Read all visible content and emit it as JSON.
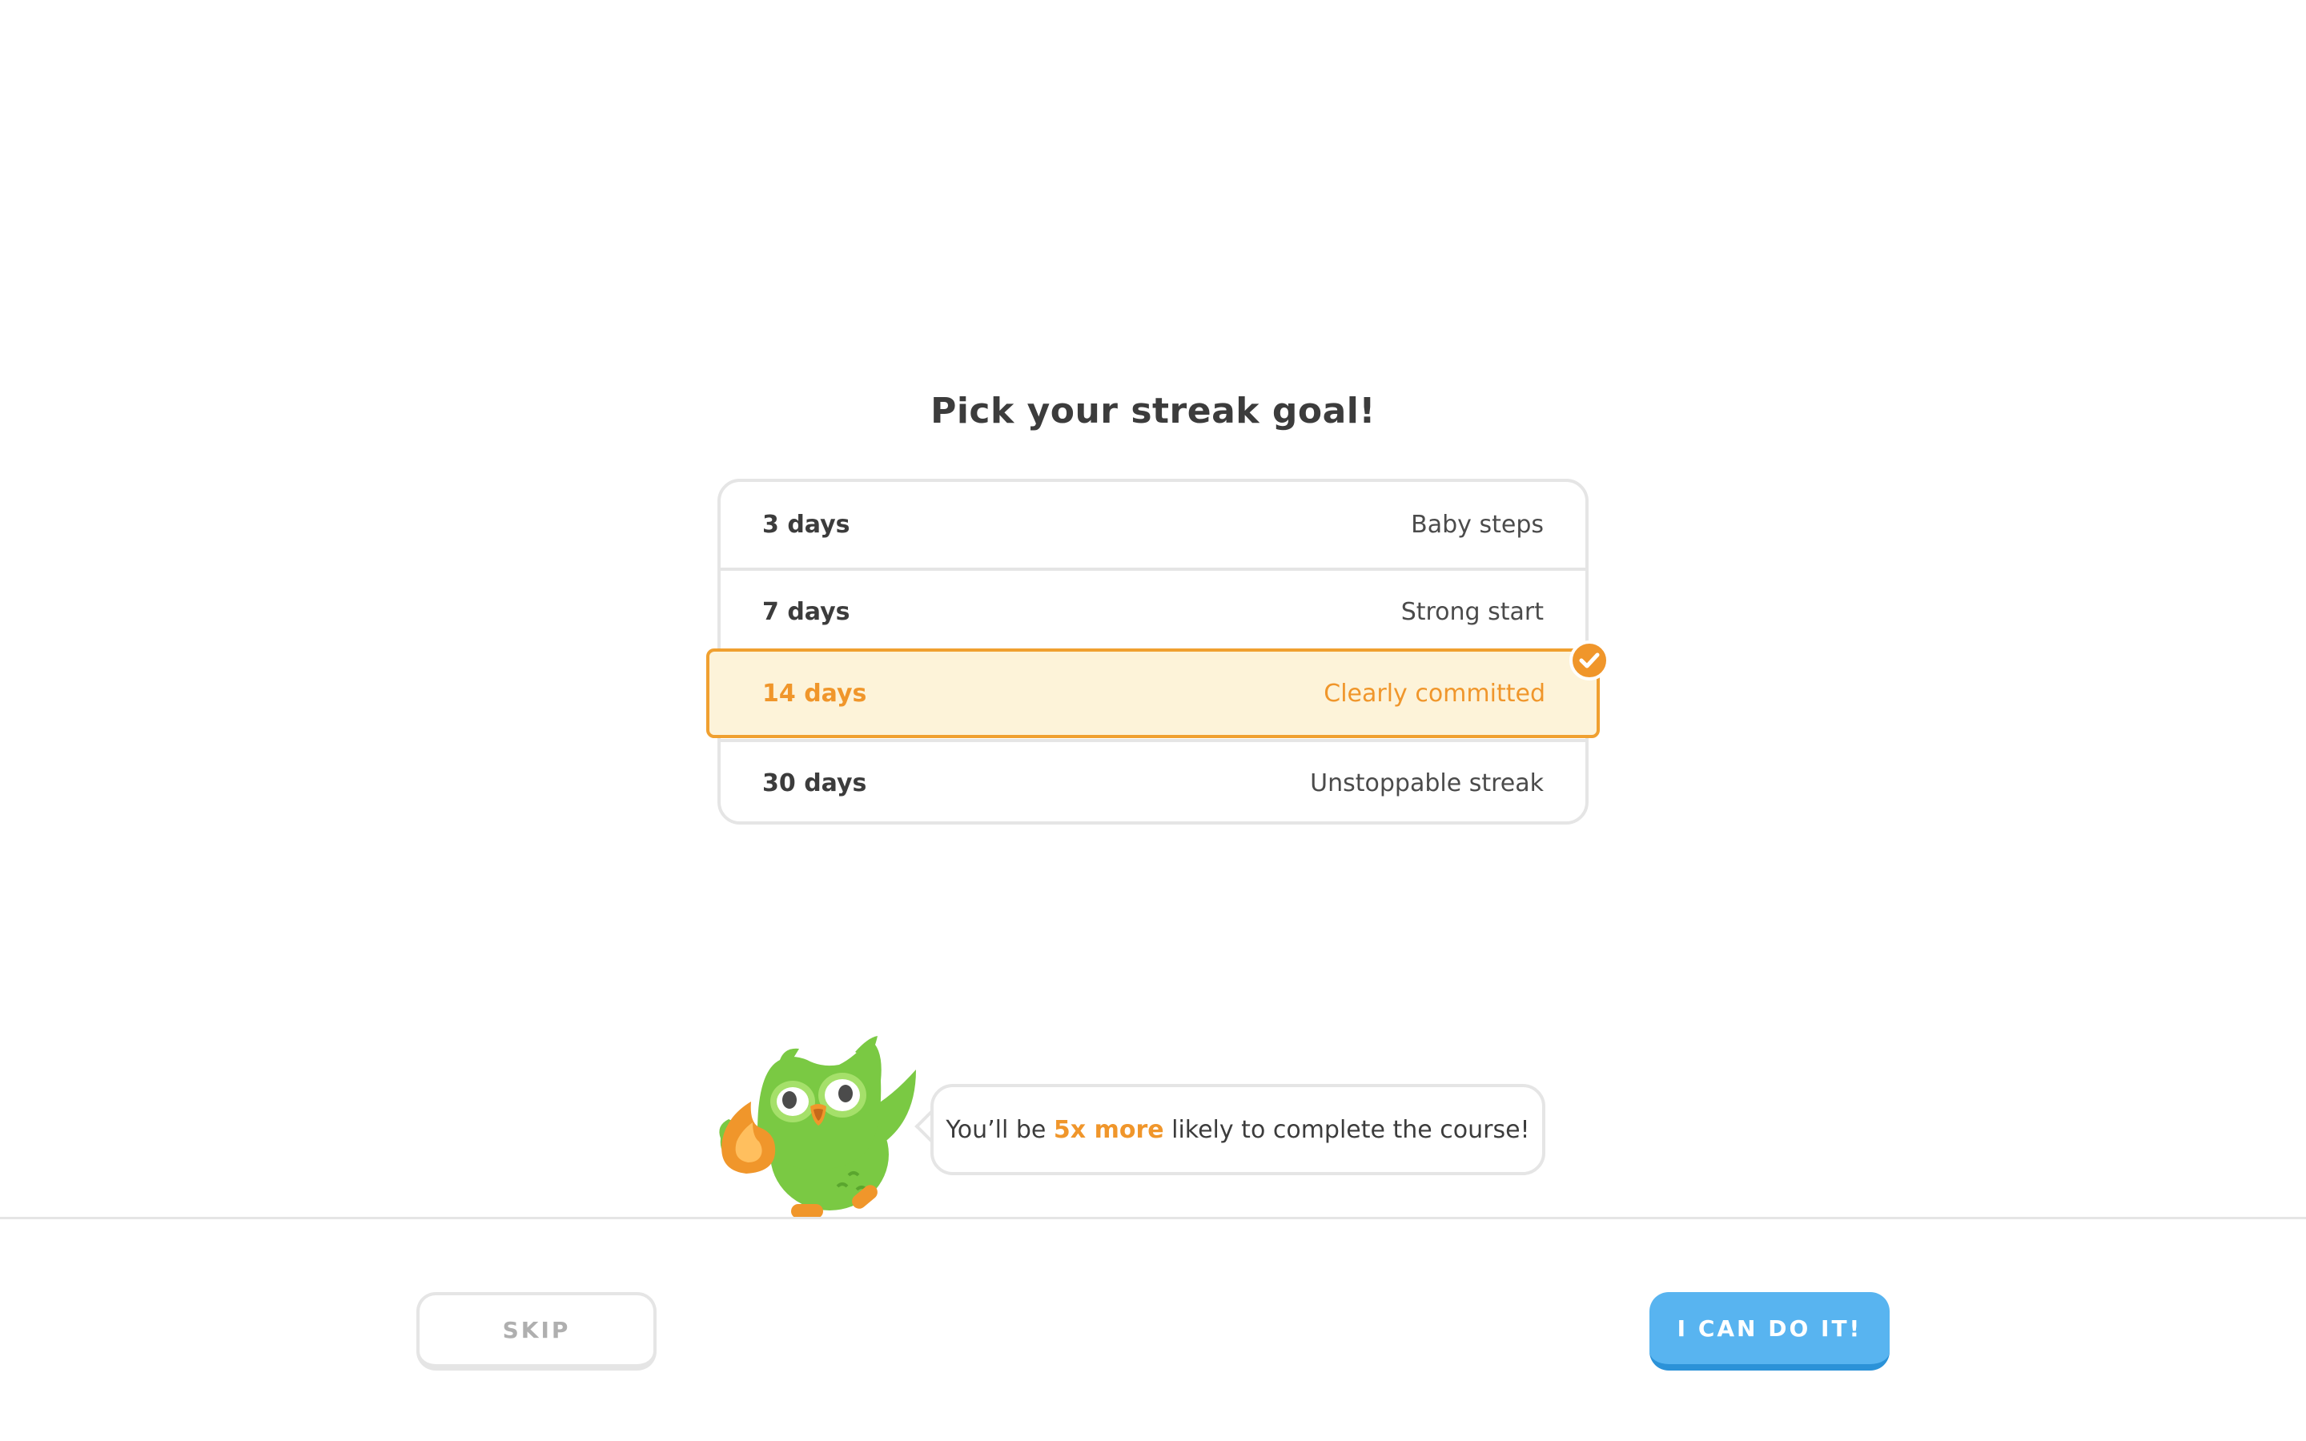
{
  "page": {
    "title": "Pick your streak goal!"
  },
  "options": [
    {
      "days": "3 days",
      "label": "Baby steps",
      "selected": false
    },
    {
      "days": "7 days",
      "label": "Strong start",
      "selected": false
    },
    {
      "days": "14 days",
      "label": "Clearly committed",
      "selected": true
    },
    {
      "days": "30 days",
      "label": "Unstoppable streak",
      "selected": false
    }
  ],
  "mascot": {
    "icon": "owl-mascot-icon",
    "prop_icon": "flame-icon"
  },
  "bubble": {
    "before": "You’ll be ",
    "highlight": "5x more",
    "after": " likely to complete the course!"
  },
  "footer": {
    "skip_label": "SKIP",
    "confirm_label": "I CAN DO IT!"
  },
  "colors": {
    "accent_orange": "#f0962b",
    "selected_bg": "#fdf3d9",
    "primary_blue": "#58b4f0",
    "owl_green": "#7ac943",
    "border_gray": "#e5e5e5"
  }
}
